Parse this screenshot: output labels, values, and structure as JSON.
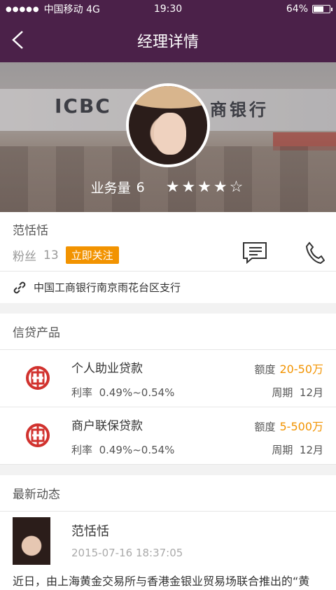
{
  "status": {
    "carrier": "中国移动 4G",
    "time": "19:30",
    "battery": "64%",
    "battery_level": 0.64
  },
  "nav": {
    "title": "经理详情"
  },
  "hero": {
    "sign_en": "ICBC",
    "sign_cn": "商银行",
    "stats_label": "业务量",
    "stats_value": "6",
    "rating": 4,
    "rating_max": 5
  },
  "profile": {
    "name": "范恬恬",
    "fans_label": "粉丝",
    "fans_count": "13",
    "follow_label": "立即关注"
  },
  "branch": {
    "name": "中国工商银行南京雨花台区支行"
  },
  "loans": {
    "title": "信贷产品",
    "items": [
      {
        "name": "个人助业贷款",
        "amount_label": "额度",
        "amount": "20-50万",
        "rate_label": "利率",
        "rate": "0.49%~0.54%",
        "period_label": "周期",
        "period": "12月"
      },
      {
        "name": "商户联保贷款",
        "amount_label": "额度",
        "amount": "5-500万",
        "rate_label": "利率",
        "rate": "0.49%~0.54%",
        "period_label": "周期",
        "period": "12月"
      }
    ]
  },
  "news": {
    "title": "最新动态",
    "author": "范恬恬",
    "time": "2015-07-16   18:37:05",
    "text": "近日，由上海黄金交易所与香港金银业贸易场联合推出的“黄"
  },
  "colors": {
    "header": "#4b2149",
    "accent": "#f29300",
    "bank_red": "#d1322e"
  }
}
